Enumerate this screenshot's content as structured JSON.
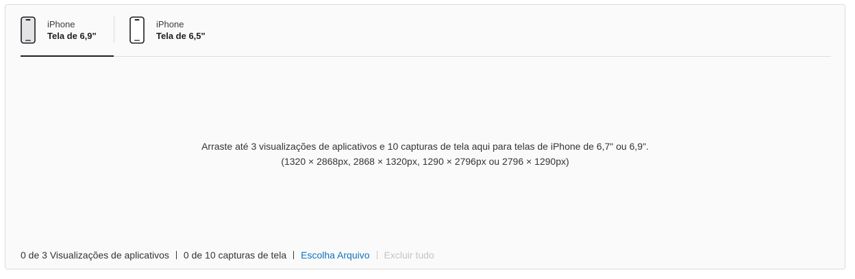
{
  "tabs": [
    {
      "kind": "iPhone",
      "size": "Tela de 6,9\"",
      "icon": "iphone-icon",
      "active": true
    },
    {
      "kind": "iPhone",
      "size": "Tela de 6,5\"",
      "icon": "iphone-icon",
      "active": false
    }
  ],
  "dropzone": {
    "line1": "Arraste até 3 visualizações de aplicativos e 10 capturas de tela aqui para telas de iPhone de 6,7\" ou 6,9\".",
    "line2": "(1320 × 2868px, 2868 × 1320px, 1290 × 2796px ou 2796 × 1290px)"
  },
  "footer": {
    "previews_count": "0 de 3 Visualizações de aplicativos",
    "screenshots_count": "0 de 10 capturas de tela",
    "choose_file": "Escolha Arquivo",
    "delete_all": "Excluir tudo"
  },
  "colors": {
    "link": "#0a72c2",
    "disabled": "#c4c4c4",
    "active_underline": "#1d1d1f"
  }
}
